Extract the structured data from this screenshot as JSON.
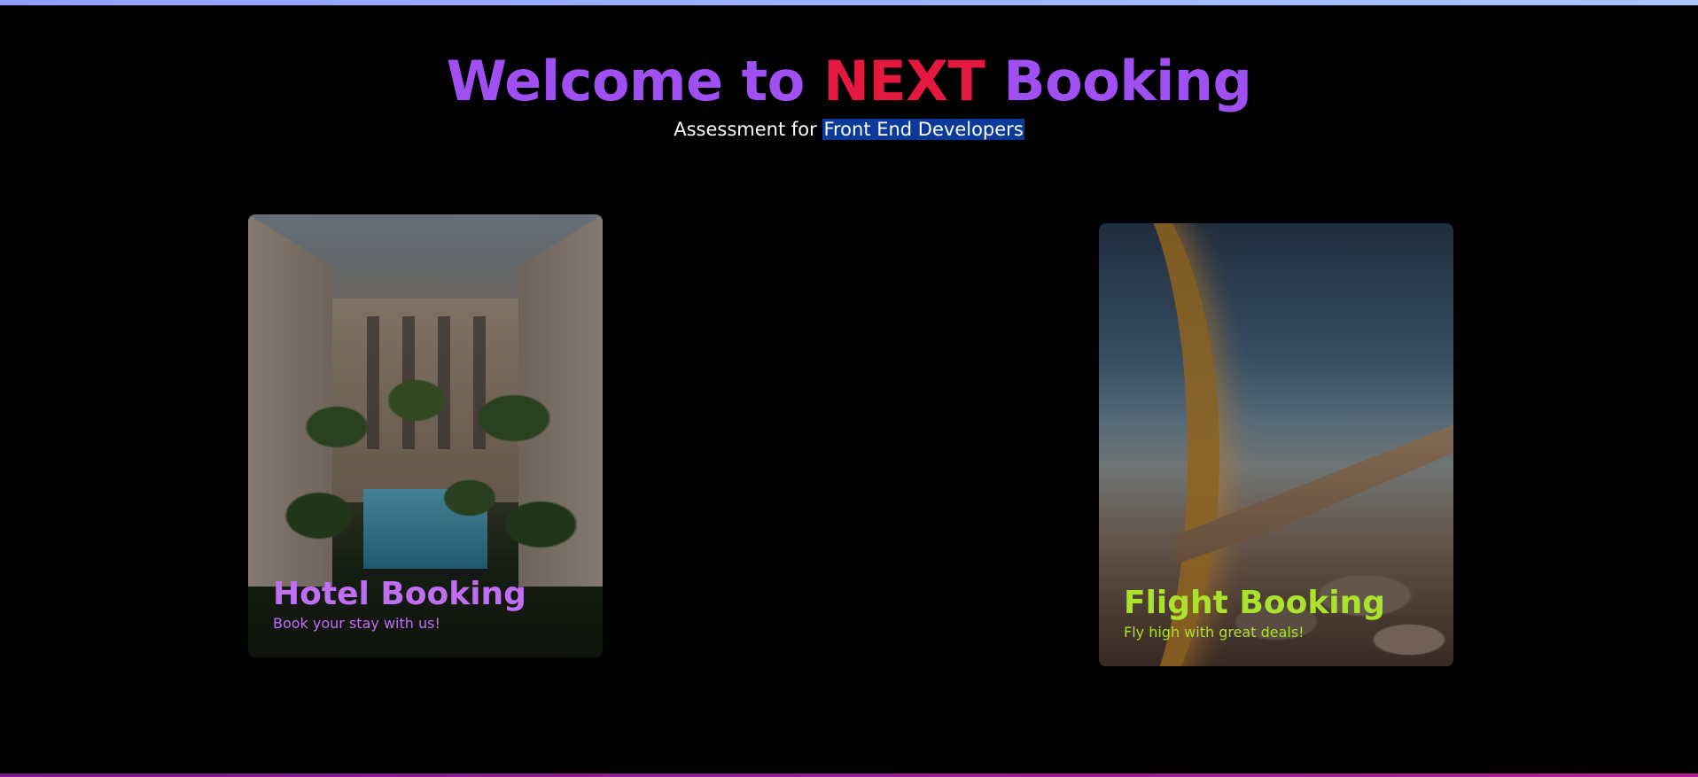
{
  "header": {
    "title_part1": "Welcome to ",
    "title_brand": "NEXT",
    "title_part2": " Booking",
    "subtitle_prefix": "Assessment for ",
    "subtitle_highlight": "Front End Developers"
  },
  "cards": [
    {
      "title": "Hotel Booking",
      "subtitle": "Book your stay with us!"
    },
    {
      "title": "Flight Booking",
      "subtitle": "Fly high with great deals!"
    }
  ],
  "colors": {
    "title_purple": "#a04ff2",
    "brand_red": "#e5183f",
    "hotel_accent": "#c06ff4",
    "flight_accent": "#a9e32c",
    "highlight_bg": "#0b3a9c"
  }
}
